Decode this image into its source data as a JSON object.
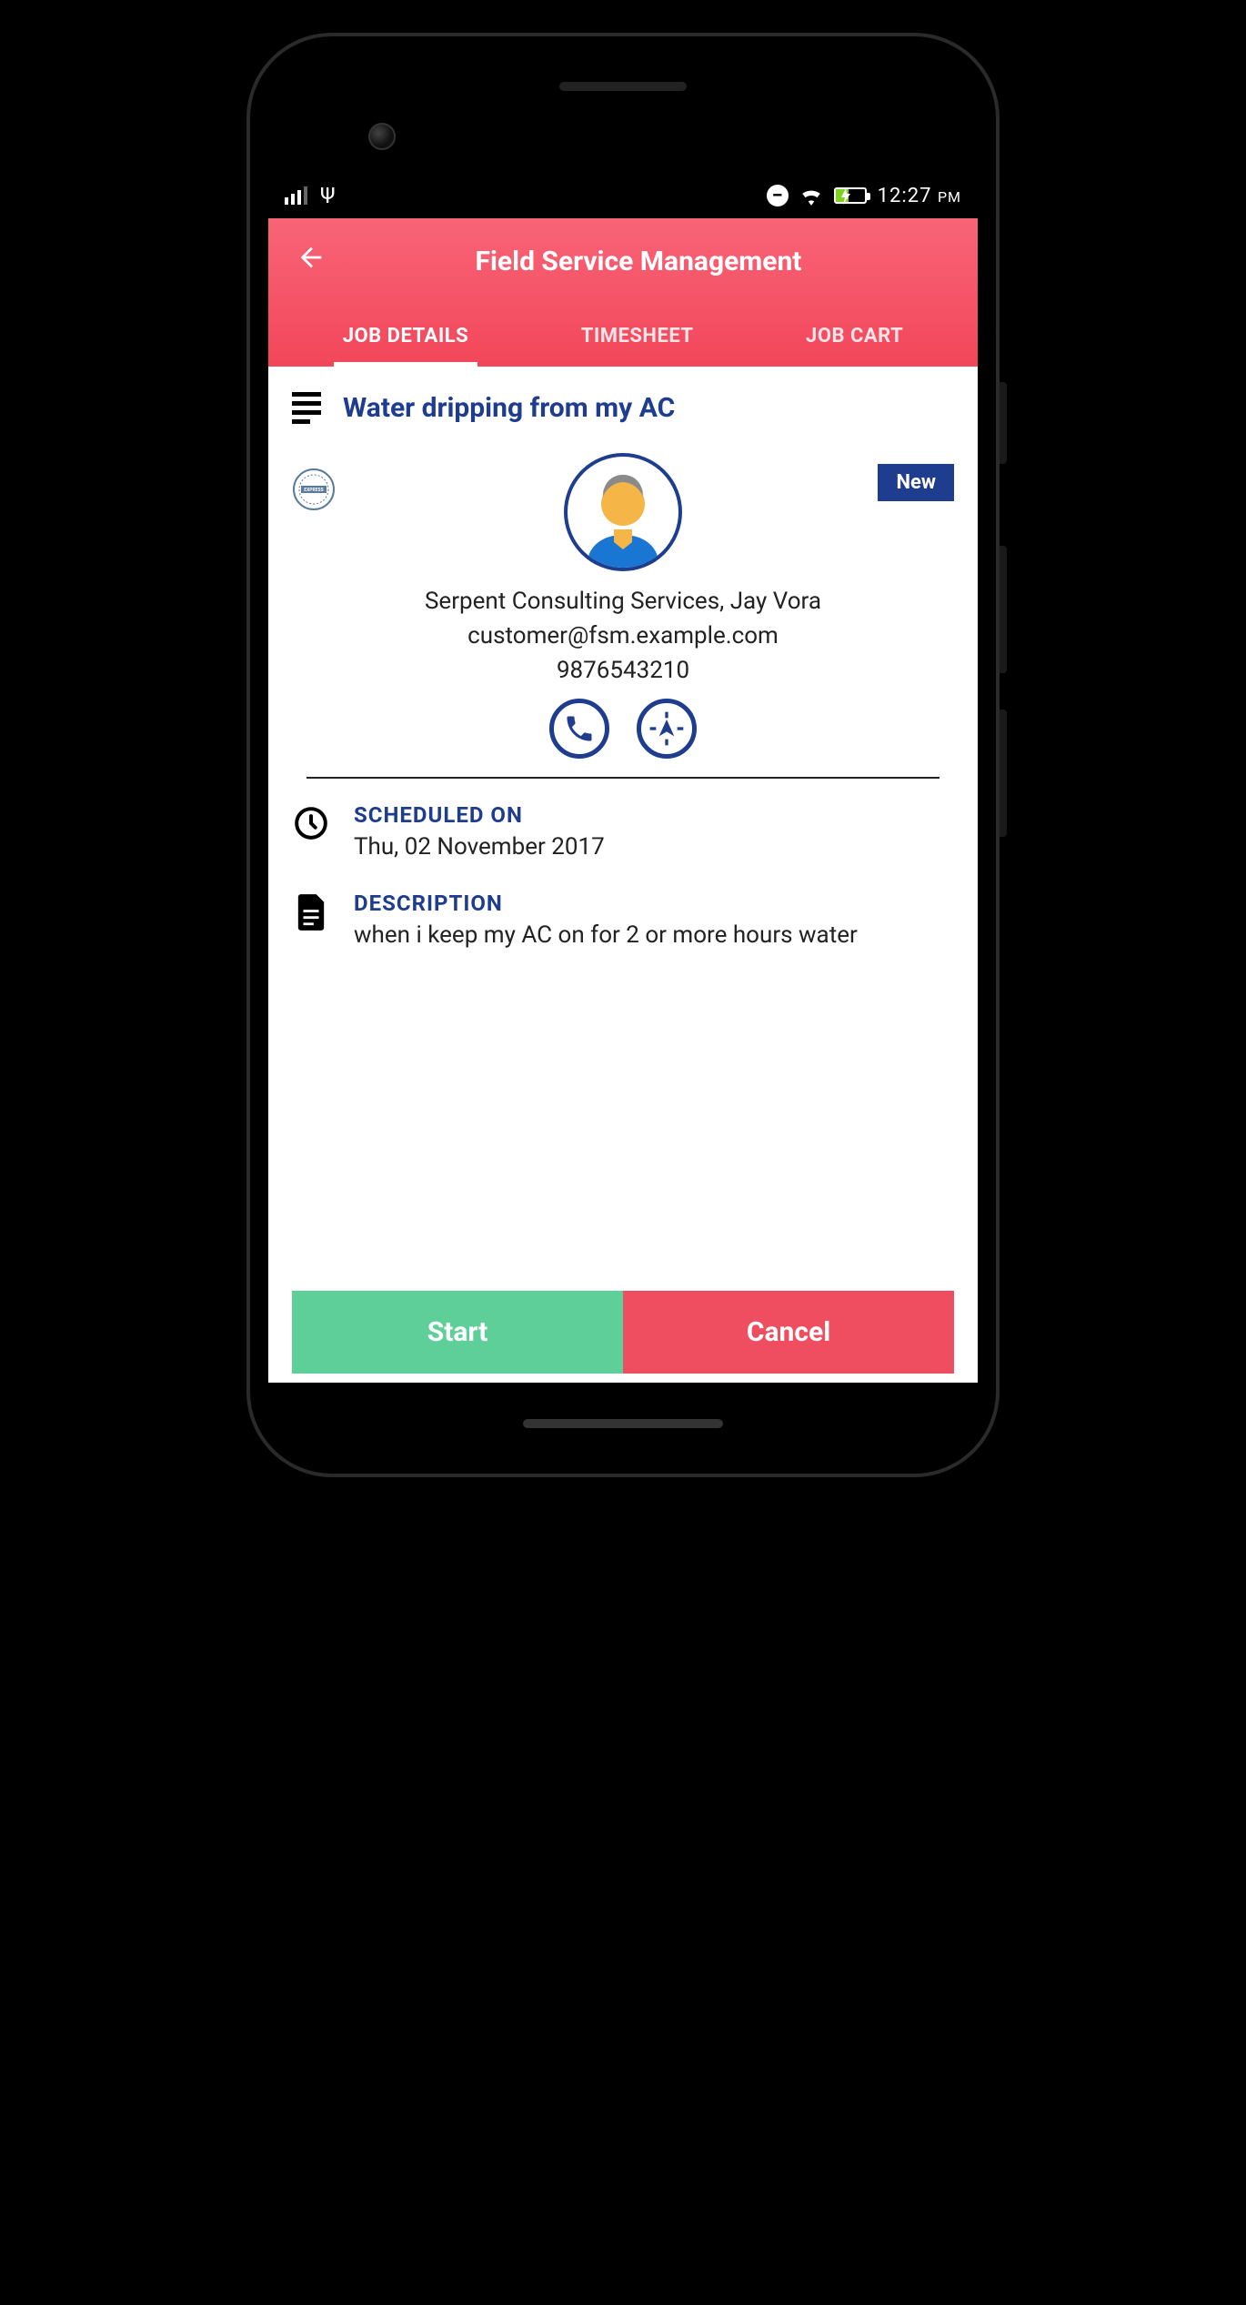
{
  "status_bar": {
    "time": "12:27",
    "period": "PM"
  },
  "header": {
    "title": "Field Service Management"
  },
  "tabs": [
    {
      "label": "JOB DETAILS",
      "active": true
    },
    {
      "label": "TIMESHEET",
      "active": false
    },
    {
      "label": "JOB CART",
      "active": false
    }
  ],
  "job": {
    "title": "Water dripping from my AC",
    "status_badge": "New",
    "customer_name": "Serpent Consulting Services, Jay Vora",
    "customer_email": "customer@fsm.example.com",
    "customer_phone": "9876543210",
    "scheduled": {
      "label": "SCHEDULED ON",
      "value": "Thu, 02 November 2017"
    },
    "description": {
      "label": "DESCRIPTION",
      "value": "when i keep my AC on for 2 or more hours water"
    }
  },
  "footer": {
    "start_label": "Start",
    "cancel_label": "Cancel"
  }
}
